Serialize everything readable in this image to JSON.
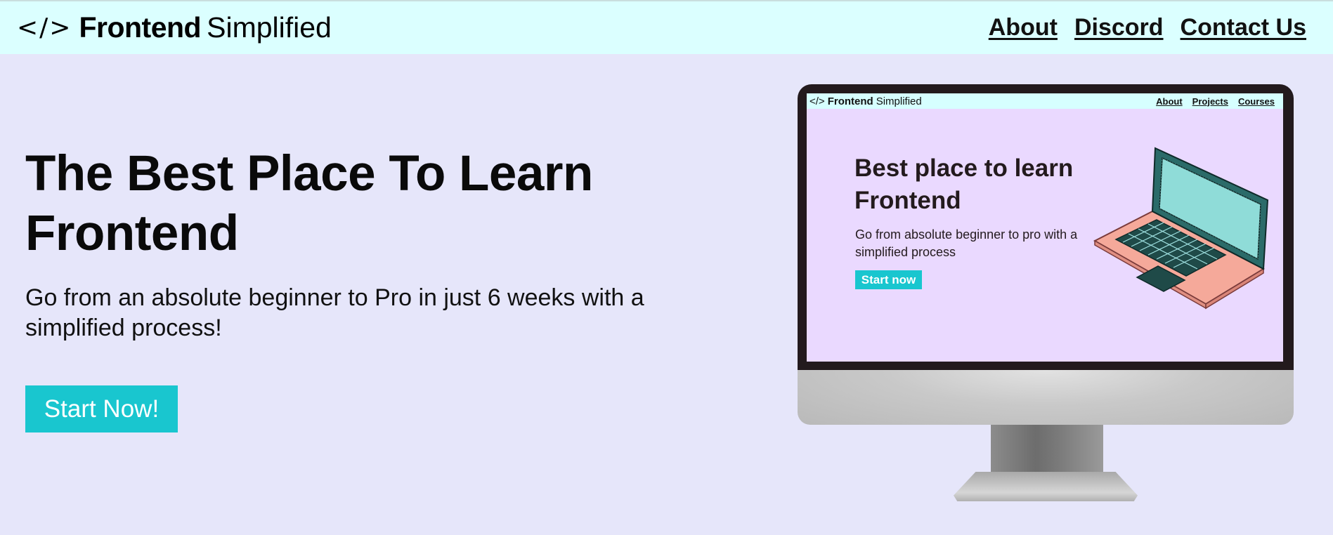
{
  "header": {
    "logo_icon": "</>",
    "brand_bold": "Frontend",
    "brand_light": "Simplified",
    "nav": [
      "About",
      "Discord",
      "Contact Us"
    ]
  },
  "hero": {
    "title": "The Best Place To Learn Frontend",
    "subtitle": "Go from an absolute beginner to Pro in just 6 weeks with a simplified process!",
    "cta": "Start Now!"
  },
  "mockup": {
    "logo_icon": "</>",
    "brand_bold": "Frontend",
    "brand_light": "Simplified",
    "nav": [
      "About",
      "Projects",
      "Courses"
    ],
    "title": "Best place to learn Frontend",
    "subtitle": "Go from absolute beginner to pro with a simplified process",
    "cta": "Start now"
  },
  "colors": {
    "page_bg": "#e6e6fa",
    "navbar_bg": "#dbffff",
    "accent": "#19c6cf",
    "mockup_bg": "#ead9ff"
  }
}
